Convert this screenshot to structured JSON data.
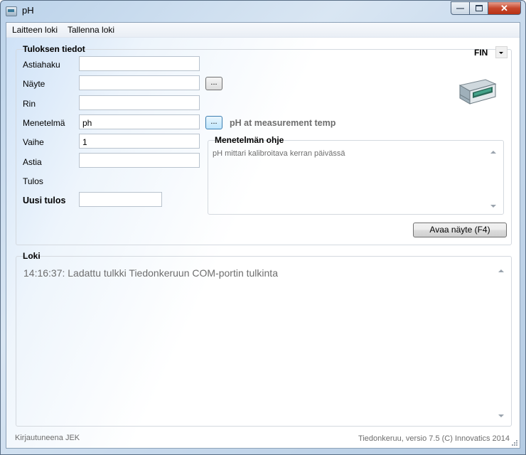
{
  "window": {
    "title": "pH"
  },
  "menu": {
    "items": [
      "Laitteen loki",
      "Tallenna loki"
    ]
  },
  "result": {
    "group_title": "Tuloksen tiedot",
    "language": "FIN",
    "fields": {
      "astiahaku": {
        "label": "Astiahaku",
        "value": ""
      },
      "nayte": {
        "label": "Näyte",
        "value": ""
      },
      "rin": {
        "label": "Rin",
        "value": ""
      },
      "menetelma": {
        "label": "Menetelmä",
        "value": "ph"
      },
      "vaihe": {
        "label": "Vaihe",
        "value": "1"
      },
      "astia": {
        "label": "Astia",
        "value": ""
      },
      "tulos": {
        "label": "Tulos"
      },
      "uusi_tulos": {
        "label": "Uusi tulos",
        "value": ""
      }
    },
    "browse_label": "...",
    "method_description": "pH at measurement temp",
    "method_help": {
      "title": "Menetelmän ohje",
      "text": "pH mittari kalibroitava kerran päivässä"
    },
    "open_sample_button": "Avaa näyte (F4)"
  },
  "log": {
    "title": "Loki",
    "lines": [
      "14:16:37: Ladattu tulkki Tiedonkeruun COM-portin tulkinta"
    ]
  },
  "status": {
    "left": "Kirjautuneena JEK",
    "right": "Tiedonkeruu, versio 7.5 (C) Innovatics 2014"
  },
  "colors": {
    "accent": "#3c7fb1",
    "close_button": "#c7472c"
  },
  "icons": {
    "app": "ph-meter-icon",
    "device": "ph-meter-device-icon"
  }
}
